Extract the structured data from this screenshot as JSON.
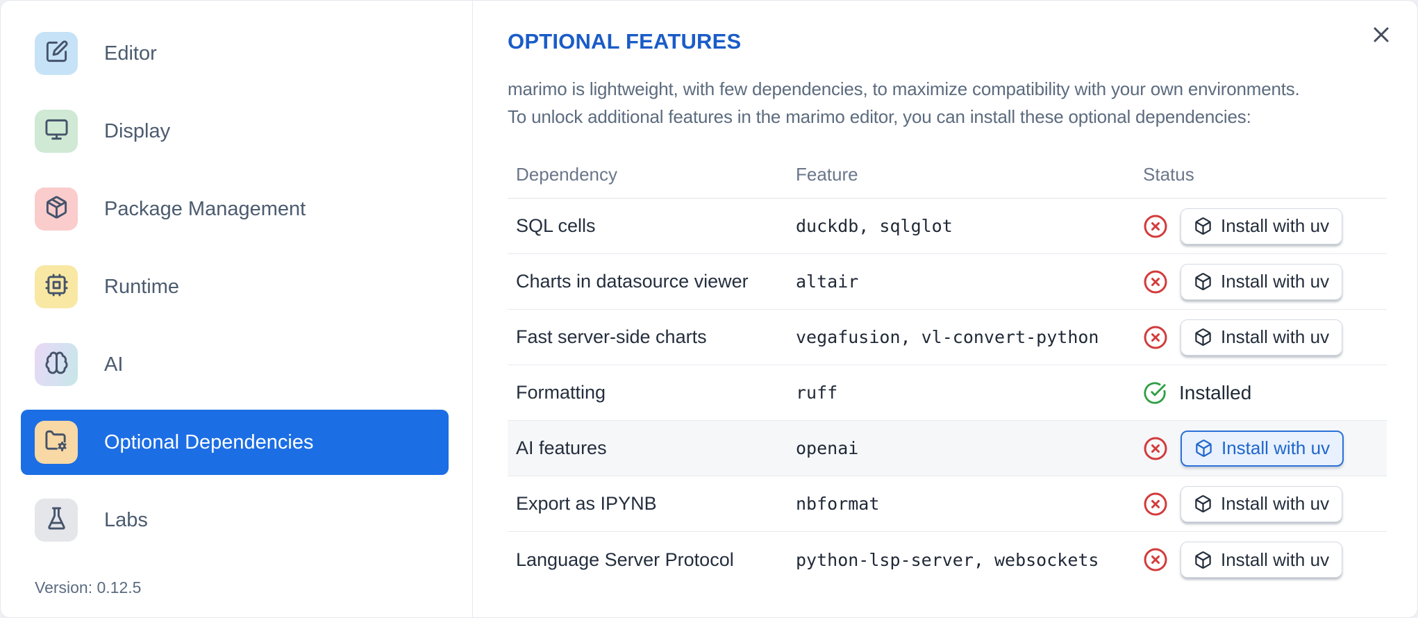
{
  "sidebar": {
    "items": [
      {
        "label": "Editor",
        "icon": "square-pen-icon",
        "tile_background": "#c6e2f7"
      },
      {
        "label": "Display",
        "icon": "monitor-icon",
        "tile_background": "#cfe9d4"
      },
      {
        "label": "Package Management",
        "icon": "package-icon",
        "tile_background": "#facccc"
      },
      {
        "label": "Runtime",
        "icon": "cpu-icon",
        "tile_background": "#f9e8a3"
      },
      {
        "label": "AI",
        "icon": "brain-icon",
        "tile_background": "linear-gradient(105deg,#e9d8f4 0%,#d9dff3 45%,#c6e7e7 100%)"
      },
      {
        "label": "Optional Dependencies",
        "icon": "folder-cog-icon",
        "tile_background": "#f8d8a5",
        "selected": true
      },
      {
        "label": "Labs",
        "icon": "flask-icon",
        "tile_background": "#e4e6ea"
      }
    ],
    "version_label": "Version: 0.12.5"
  },
  "dialog": {
    "title": "OPTIONAL FEATURES",
    "description_lines": [
      "marimo is lightweight, with few dependencies, to maximize compatibility with your own environments.",
      "To unlock additional features in the marimo editor, you can install these optional dependencies:"
    ]
  },
  "table": {
    "headers": [
      "Dependency",
      "Feature",
      "Status"
    ],
    "install_button_label": "Install with uv",
    "installed_label": "Installed",
    "rows": [
      {
        "dependency": "SQL cells",
        "feature": "duckdb, sqlglot",
        "installed": false
      },
      {
        "dependency": "Charts in datasource viewer",
        "feature": "altair",
        "installed": false
      },
      {
        "dependency": "Fast server-side charts",
        "feature": "vegafusion, vl-convert-python",
        "installed": false
      },
      {
        "dependency": "Formatting",
        "feature": "ruff",
        "installed": true
      },
      {
        "dependency": "AI features",
        "feature": "openai",
        "installed": false,
        "highlighted": true
      },
      {
        "dependency": "Export as IPYNB",
        "feature": "nbformat",
        "installed": false
      },
      {
        "dependency": "Language Server Protocol",
        "feature": "python-lsp-server, websockets",
        "installed": false
      }
    ]
  },
  "colors": {
    "accent_blue": "#1c6ee4",
    "title_blue": "#1a5cc8",
    "error_red": "#d23b3b",
    "success_green": "#2f9e44"
  }
}
